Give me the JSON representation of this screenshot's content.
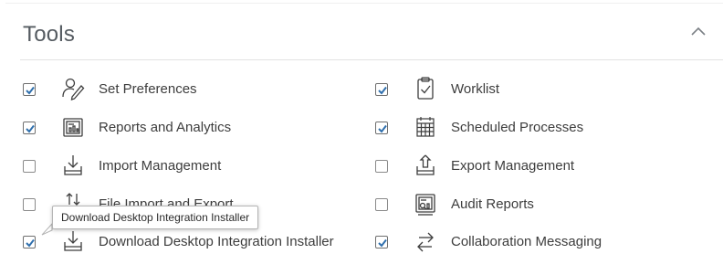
{
  "panel": {
    "title": "Tools",
    "collapse_icon": "chevron-up-icon"
  },
  "tools": [
    {
      "label": "Set Preferences",
      "checked": true,
      "icon": "set-preferences-icon"
    },
    {
      "label": "Worklist",
      "checked": true,
      "icon": "worklist-icon"
    },
    {
      "label": "Reports and Analytics",
      "checked": true,
      "icon": "reports-analytics-icon"
    },
    {
      "label": "Scheduled Processes",
      "checked": true,
      "icon": "calendar-icon"
    },
    {
      "label": "Import Management",
      "checked": false,
      "icon": "import-icon"
    },
    {
      "label": "Export Management",
      "checked": false,
      "icon": "export-icon"
    },
    {
      "label": "File Import and Export",
      "checked": false,
      "icon": "file-import-export-icon"
    },
    {
      "label": "Audit Reports",
      "checked": false,
      "icon": "audit-reports-icon"
    },
    {
      "label": "Download Desktop Integration Installer",
      "checked": true,
      "icon": "download-icon"
    },
    {
      "label": "Collaboration Messaging",
      "checked": true,
      "icon": "collaboration-icon"
    }
  ],
  "tooltip": {
    "text": "Download Desktop Integration Installer"
  },
  "colors": {
    "check": "#2f6fad",
    "icon_stroke": "#3d3d3d"
  }
}
